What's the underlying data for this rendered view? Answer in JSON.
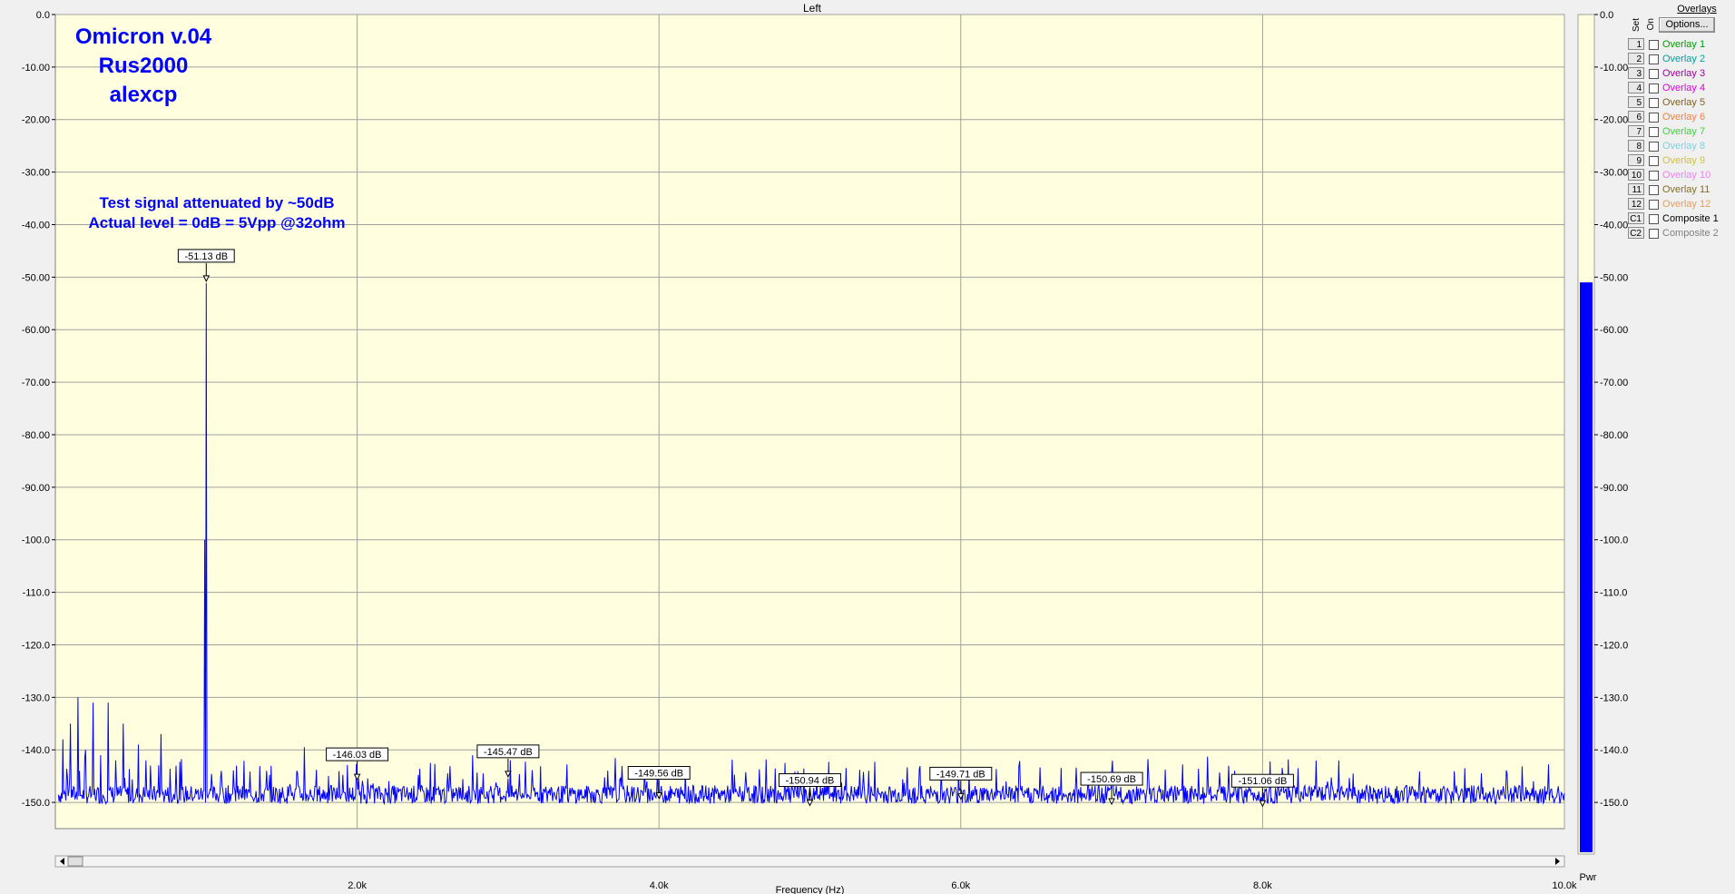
{
  "window": {
    "title": "Left"
  },
  "annotations": {
    "title_lines": [
      "Omicron v.04",
      "Rus2000",
      "alexcp"
    ],
    "note_lines": [
      "Test signal attenuated by ~50dB",
      "Actual level = 0dB = 5Vpp @32ohm"
    ]
  },
  "chart_data": {
    "type": "line",
    "title": "Left",
    "xlabel": "Frequency (Hz)",
    "ylabel": "",
    "xlim": [
      0,
      10000
    ],
    "ylim": [
      -155,
      0
    ],
    "x_ticks": [
      2000,
      4000,
      6000,
      8000,
      10000
    ],
    "x_tick_labels": [
      "2.0k",
      "4.0k",
      "6.0k",
      "8.0k",
      "10.0k"
    ],
    "y_ticks": [
      0,
      -10,
      -20,
      -30,
      -40,
      -50,
      -60,
      -70,
      -80,
      -90,
      -100,
      -110,
      -120,
      -130,
      -140,
      -150
    ],
    "y_tick_labels": [
      "0.0",
      "-10.00",
      "-20.00",
      "-30.00",
      "-40.00",
      "-50.00",
      "-60.00",
      "-70.00",
      "-80.00",
      "-90.00",
      "-100.0",
      "-110.0",
      "-120.0",
      "-130.0",
      "-140.0",
      "-150.0"
    ],
    "grid": true,
    "noise_floor_db": -148.5,
    "series": [
      {
        "color": "#0000ff",
        "peaks": [
          {
            "x": 1000,
            "y": -51.13
          },
          {
            "x": 990,
            "y": -100
          },
          {
            "x": 50,
            "y": -138
          },
          {
            "x": 100,
            "y": -135
          },
          {
            "x": 150,
            "y": -130
          },
          {
            "x": 200,
            "y": -140
          },
          {
            "x": 250,
            "y": -131
          },
          {
            "x": 300,
            "y": -141
          },
          {
            "x": 350,
            "y": -131
          },
          {
            "x": 400,
            "y": -142
          },
          {
            "x": 450,
            "y": -135
          },
          {
            "x": 550,
            "y": -139
          },
          {
            "x": 600,
            "y": -142
          },
          {
            "x": 700,
            "y": -137
          },
          {
            "x": 800,
            "y": -143
          },
          {
            "x": 1100,
            "y": -144
          },
          {
            "x": 1200,
            "y": -143
          },
          {
            "x": 1400,
            "y": -144
          },
          {
            "x": 1600,
            "y": -144
          },
          {
            "x": 1650,
            "y": -139.5
          },
          {
            "x": 2000,
            "y": -146.03
          },
          {
            "x": 2600,
            "y": -144.5
          },
          {
            "x": 3000,
            "y": -145.47
          },
          {
            "x": 3920,
            "y": -146
          },
          {
            "x": 5000,
            "y": -150.94
          },
          {
            "x": 6000,
            "y": -149.71
          },
          {
            "x": 6300,
            "y": -146
          },
          {
            "x": 7000,
            "y": -150.69
          },
          {
            "x": 8000,
            "y": -151.06
          }
        ]
      }
    ],
    "markers": [
      {
        "x": 1000,
        "y": -51.13,
        "label": "-51.13 dB"
      },
      {
        "x": 2000,
        "y": -146.03,
        "label": "-146.03 dB"
      },
      {
        "x": 3000,
        "y": -145.47,
        "label": "-145.47 dB"
      },
      {
        "x": 4000,
        "y": -149.56,
        "label": "-149.56 dB"
      },
      {
        "x": 5000,
        "y": -150.94,
        "label": "-150.94 dB"
      },
      {
        "x": 6000,
        "y": -149.71,
        "label": "-149.71 dB"
      },
      {
        "x": 7000,
        "y": -150.69,
        "label": "-150.69 dB"
      },
      {
        "x": 8000,
        "y": -151.06,
        "label": "-151.06 dB"
      }
    ],
    "power_meter": {
      "label": "Pwr",
      "value_db": -51,
      "ticks": [
        0,
        -10,
        -20,
        -30,
        -40,
        -50,
        -60,
        -70,
        -80,
        -90,
        -100,
        -110,
        -120,
        -130,
        -140,
        -150
      ],
      "tick_labels": [
        "0.0",
        "-10.00",
        "-20.00",
        "-30.00",
        "-40.00",
        "-50.00",
        "-60.00",
        "-70.00",
        "-80.00",
        "-90.00",
        "-100.0",
        "-110.0",
        "-120.0",
        "-130.0",
        "-140.0",
        "-150.0"
      ],
      "color": "#0000ff"
    }
  },
  "overlays": {
    "title": "Overlays",
    "col_set": "Set",
    "col_on": "On",
    "options_label": "Options...",
    "items": [
      {
        "num": "1",
        "label": "Overlay 1",
        "color": "#00a000"
      },
      {
        "num": "2",
        "label": "Overlay 2",
        "color": "#00a0a0"
      },
      {
        "num": "3",
        "label": "Overlay 3",
        "color": "#a000a0"
      },
      {
        "num": "4",
        "label": "Overlay 4",
        "color": "#e000e0"
      },
      {
        "num": "5",
        "label": "Overlay 5",
        "color": "#806020"
      },
      {
        "num": "6",
        "label": "Overlay 6",
        "color": "#f08040"
      },
      {
        "num": "7",
        "label": "Overlay 7",
        "color": "#40d040"
      },
      {
        "num": "8",
        "label": "Overlay 8",
        "color": "#80d0e0"
      },
      {
        "num": "9",
        "label": "Overlay 9",
        "color": "#d0c040"
      },
      {
        "num": "10",
        "label": "Overlay 10",
        "color": "#f080f0"
      },
      {
        "num": "11",
        "label": "Overlay 11",
        "color": "#807020"
      },
      {
        "num": "12",
        "label": "Overlay 12",
        "color": "#e0a060"
      },
      {
        "num": "C1",
        "label": "Composite 1",
        "color": "#000000"
      },
      {
        "num": "C2",
        "label": "Composite 2",
        "color": "#808080"
      }
    ]
  }
}
